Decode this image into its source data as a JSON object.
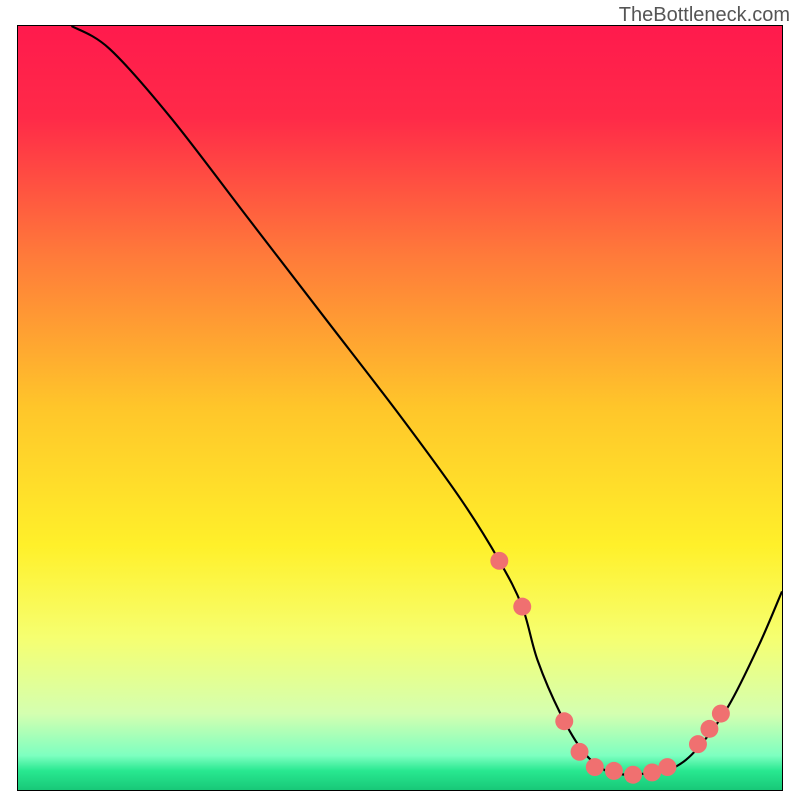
{
  "watermark": "TheBottleneck.com",
  "chart_data": {
    "type": "line",
    "title": "",
    "xlabel": "",
    "ylabel": "",
    "xlim": [
      0,
      100
    ],
    "ylim": [
      0,
      100
    ],
    "background_gradient": {
      "stops": [
        {
          "pos": 0.0,
          "color": "#ff1a4d"
        },
        {
          "pos": 0.12,
          "color": "#ff2a48"
        },
        {
          "pos": 0.3,
          "color": "#ff7a3a"
        },
        {
          "pos": 0.5,
          "color": "#ffc62a"
        },
        {
          "pos": 0.68,
          "color": "#fff02a"
        },
        {
          "pos": 0.8,
          "color": "#f6ff70"
        },
        {
          "pos": 0.9,
          "color": "#d4ffb0"
        },
        {
          "pos": 0.955,
          "color": "#7dffc0"
        },
        {
          "pos": 0.975,
          "color": "#28e890"
        },
        {
          "pos": 1.0,
          "color": "#18c878"
        }
      ]
    },
    "series": [
      {
        "name": "bottleneck-curve",
        "x": [
          7,
          12,
          20,
          30,
          40,
          50,
          58,
          63,
          66,
          68,
          71,
          74,
          77,
          80,
          83,
          86,
          89,
          93,
          97,
          100
        ],
        "y": [
          100,
          97,
          88,
          75,
          62,
          49,
          38,
          30,
          24,
          17,
          10,
          5,
          2.5,
          2,
          2.3,
          3,
          5.5,
          11,
          19,
          26
        ]
      }
    ],
    "markers": {
      "name": "highlight-dots",
      "color": "#f07070",
      "radius": 9,
      "points": [
        {
          "x": 63,
          "y": 30
        },
        {
          "x": 66,
          "y": 24
        },
        {
          "x": 71.5,
          "y": 9
        },
        {
          "x": 73.5,
          "y": 5
        },
        {
          "x": 75.5,
          "y": 3
        },
        {
          "x": 78,
          "y": 2.5
        },
        {
          "x": 80.5,
          "y": 2
        },
        {
          "x": 83,
          "y": 2.3
        },
        {
          "x": 85,
          "y": 3
        },
        {
          "x": 89,
          "y": 6
        },
        {
          "x": 90.5,
          "y": 8
        },
        {
          "x": 92,
          "y": 10
        }
      ]
    }
  }
}
